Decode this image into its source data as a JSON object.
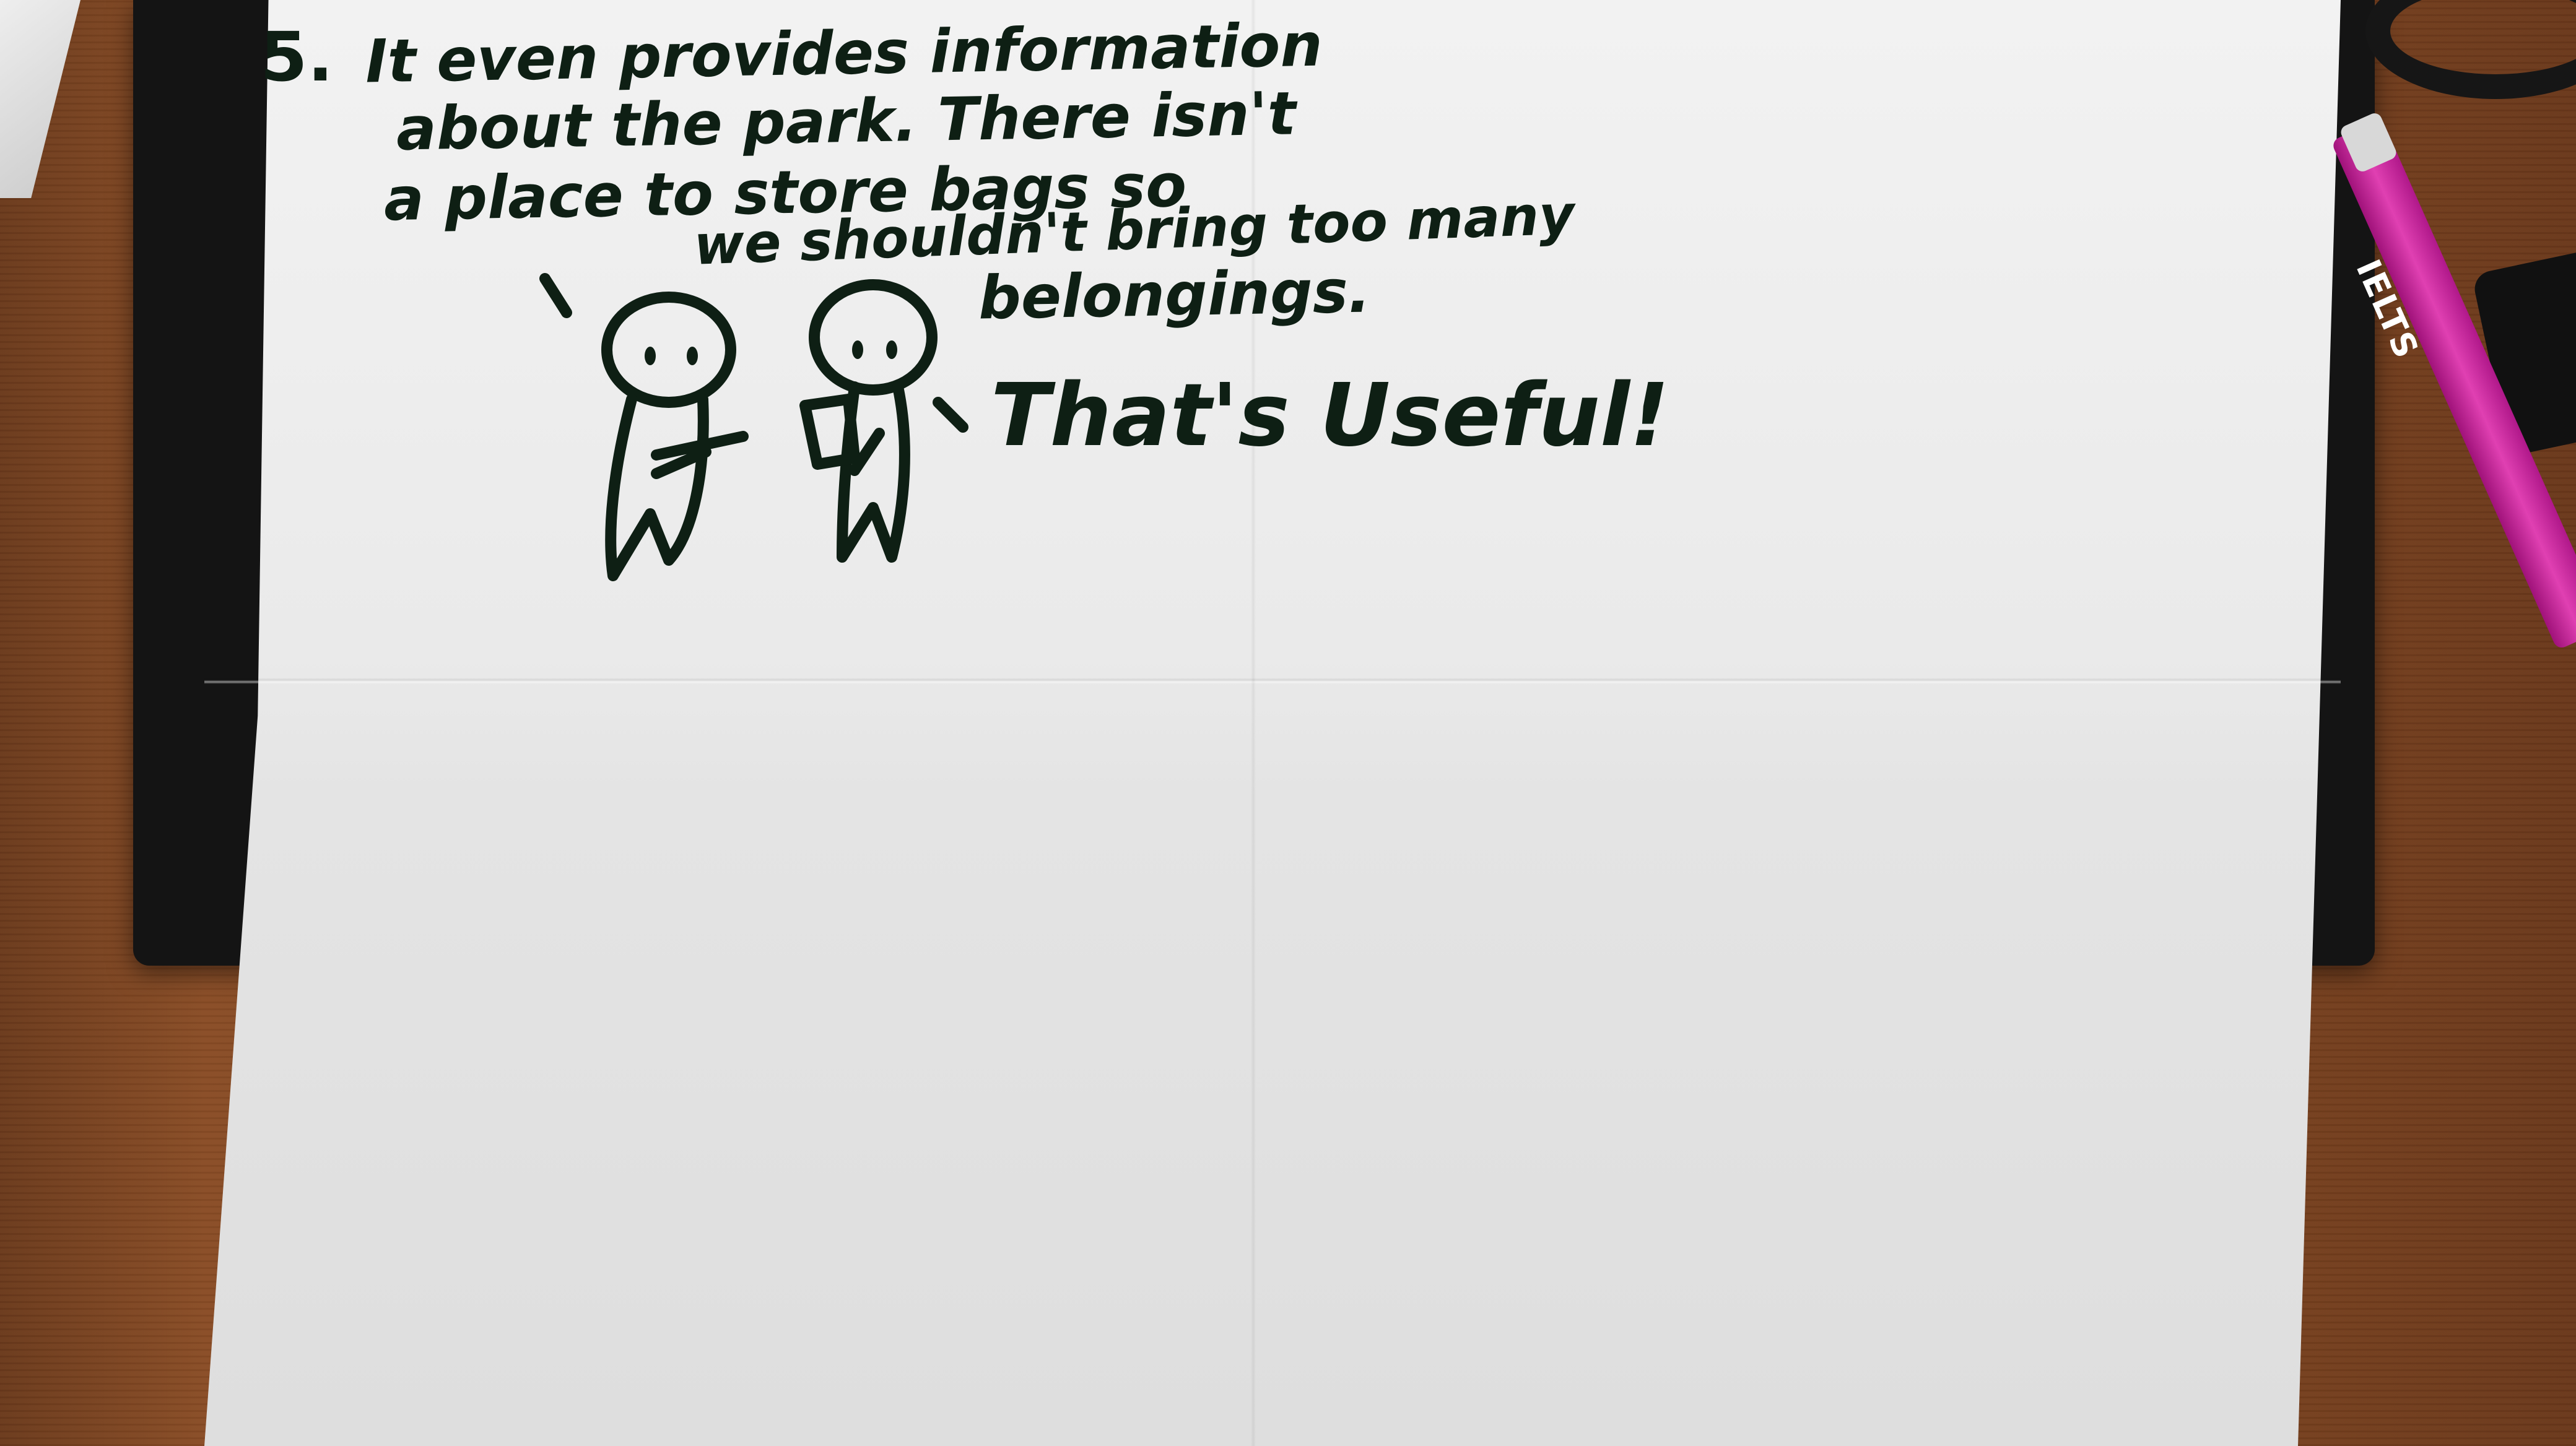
{
  "note": {
    "number": "5.",
    "lines": [
      "It even provides information",
      "about the park. There isn't",
      "a place to store bags so",
      "we shouldn't bring too many",
      "belongings."
    ],
    "speech": "That's Useful!"
  },
  "pen": {
    "label": "IELTS",
    "color": "#e040b2"
  },
  "colors": {
    "ink": "#0e1f14",
    "paper": "#eaeaea",
    "desk": "#8a4d26"
  }
}
